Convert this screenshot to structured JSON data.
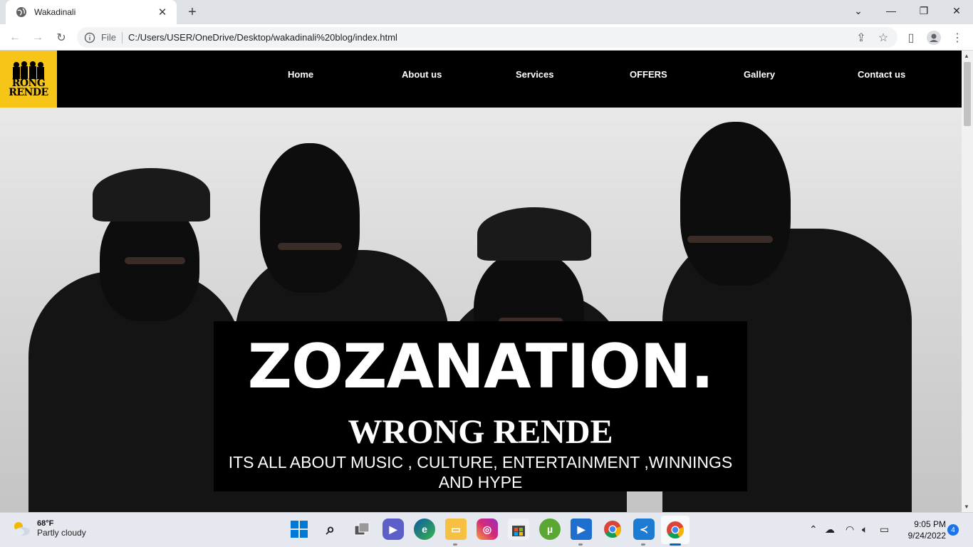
{
  "browser": {
    "tab_title": "Wakadinali",
    "new_tab_symbol": "+",
    "file_label": "File",
    "url": "C:/Users/USER/OneDrive/Desktop/wakadinali%20blog/index.html"
  },
  "site": {
    "logo_lines": [
      "RONG",
      "RENDE"
    ],
    "nav": [
      "Home",
      "About us",
      "Services",
      "OFFERS",
      "Gallery",
      "Contact us"
    ],
    "hero_title": "ZOZANATION.",
    "hero_subtitle": "WRONG RENDE",
    "hero_tagline": "ITS ALL ABOUT MUSIC , CULTURE, ENTERTAINMENT ,WINNINGS AND HYPE"
  },
  "taskbar": {
    "weather_temp": "68°F",
    "weather_condition": "Partly cloudy",
    "time": "9:05 PM",
    "date": "9/24/2022",
    "notifications": "4"
  },
  "colors": {
    "logo_bg": "#f5c518",
    "nav_bg": "#000000",
    "accent": "#1a73e8"
  }
}
